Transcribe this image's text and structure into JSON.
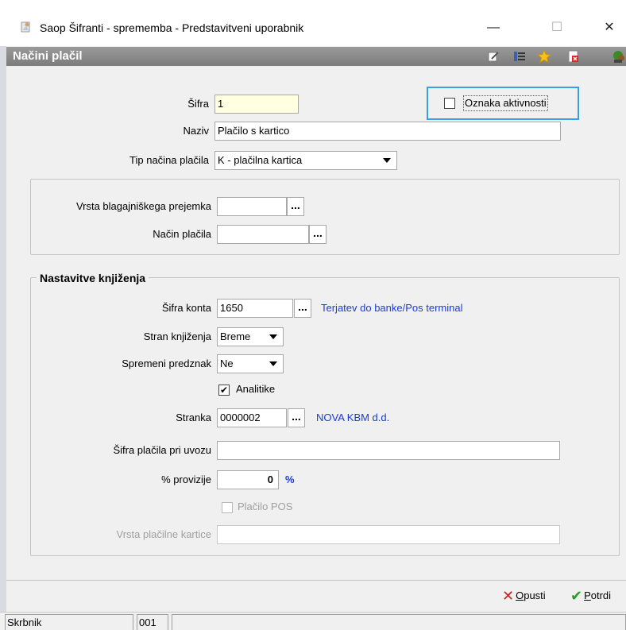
{
  "window": {
    "title": "Saop Šifranti - sprememba - Predstavitveni uporabnik",
    "minimize": "—",
    "maximize": "☐",
    "close": "✕"
  },
  "header": {
    "title": "Načini plačil",
    "toolbar_icons": [
      "edit-icon",
      "list-icon",
      "star-icon",
      "delete-icon",
      "exit-icon"
    ]
  },
  "form": {
    "sifra": {
      "label": "Šifra",
      "value": "1"
    },
    "oznaka_aktivnosti": {
      "label": "Oznaka aktivnosti",
      "checked": false
    },
    "naziv": {
      "label": "Naziv",
      "value": "Plačilo s kartico"
    },
    "tip_nacina_placila": {
      "label": "Tip načina plačila",
      "value": "K - plačilna kartica"
    },
    "vrsta_blagajniskega_prejemka": {
      "label": "Vrsta blagajniškega prejemka",
      "value": "",
      "button": "..."
    },
    "nacin_placila": {
      "label": "Način plačila",
      "value": "",
      "button": "..."
    }
  },
  "knjizenje": {
    "group_title": "Nastavitve knjiženja",
    "sifra_konta": {
      "label": "Šifra konta",
      "value": "1650",
      "button": "...",
      "description": "Terjatev do banke/Pos terminal"
    },
    "stran_knjizenja": {
      "label": "Stran knjiženja",
      "value": "Breme"
    },
    "spremeni_predznak": {
      "label": "Spremeni predznak",
      "value": "Ne"
    },
    "analitike": {
      "label": "Analitike",
      "checked": true,
      "mark": "✔"
    },
    "stranka": {
      "label": "Stranka",
      "value": "0000002",
      "button": "...",
      "description": "NOVA KBM d.d."
    },
    "sifra_placila_pri_uvozu": {
      "label": "Šifra plačila pri uvozu",
      "value": ""
    },
    "provizije": {
      "label": "% provizije",
      "value": "0",
      "unit": "%"
    },
    "placilo_pos": {
      "label": "Plačilo POS",
      "checked": false,
      "enabled": false
    },
    "vrsta_placilne_kartice": {
      "label": "Vrsta plačilne kartice",
      "value": "",
      "enabled": false
    }
  },
  "footer": {
    "cancel_mark": "✕",
    "cancel_first": "O",
    "cancel_rest": "pusti",
    "confirm_mark": "✔",
    "confirm_first": "P",
    "confirm_rest": "otrdi"
  },
  "status": {
    "user": "Skrbnik",
    "code": "001",
    "message": ""
  },
  "colors": {
    "link": "#1a3bd6",
    "header_bg": "#8a8a8a",
    "focus_border": "#3a9fe0",
    "required_bg": "#ffffe1"
  }
}
